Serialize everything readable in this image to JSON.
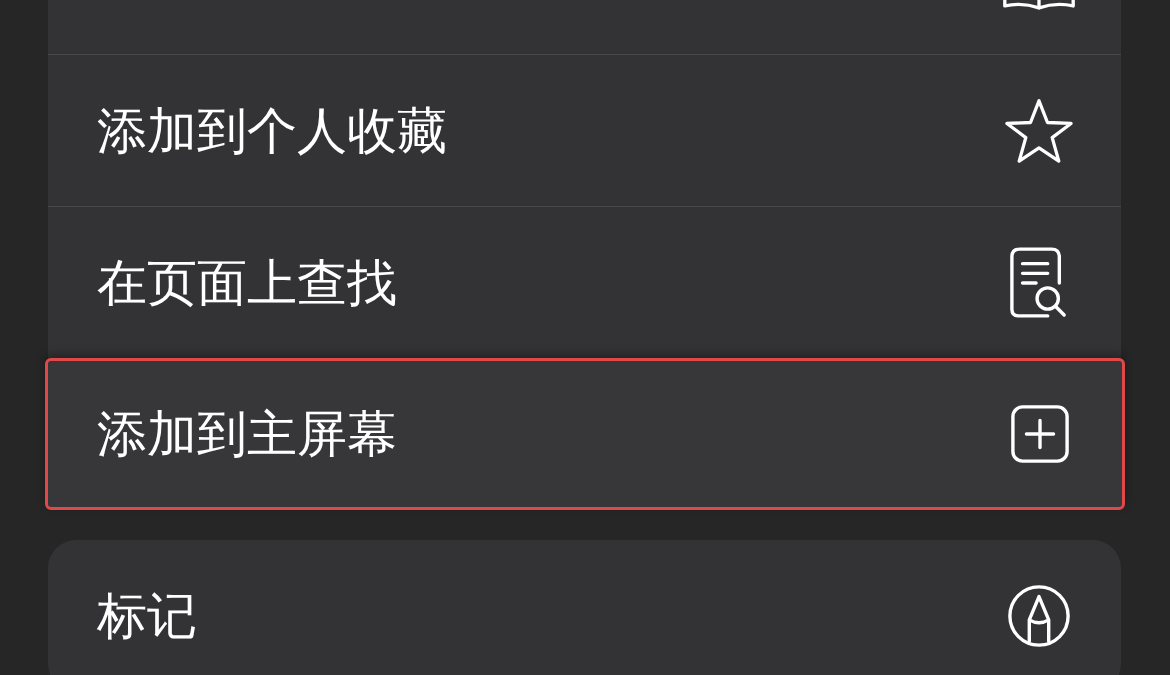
{
  "groups": [
    {
      "items": [
        {
          "highlighted": false
        },
        {
          "label": "添加到个人收藏",
          "highlighted": false
        },
        {
          "label": "在页面上查找",
          "highlighted": false
        },
        {
          "label": "添加到主屏幕",
          "highlighted": true
        }
      ]
    },
    {
      "items": [
        {
          "label": "标记",
          "highlighted": false
        }
      ]
    }
  ]
}
